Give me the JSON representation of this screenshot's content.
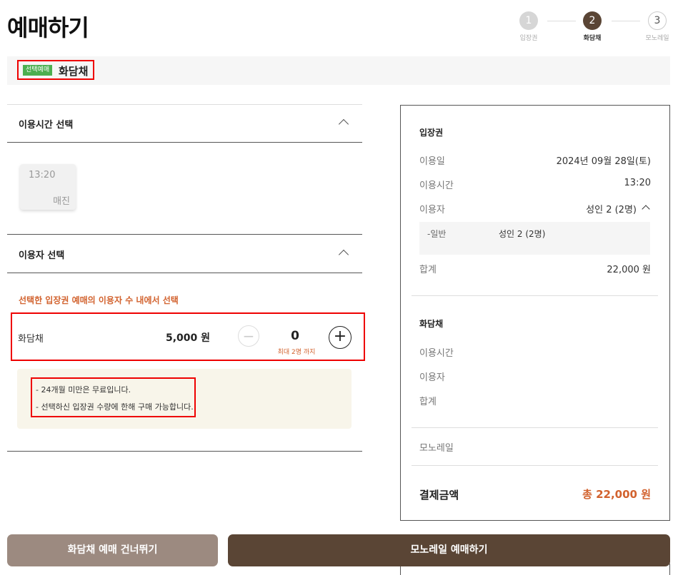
{
  "page": {
    "title": "예매하기"
  },
  "steps": [
    {
      "num": "1",
      "label": "입장권"
    },
    {
      "num": "2",
      "label": "화담채"
    },
    {
      "num": "3",
      "label": "모노레일"
    }
  ],
  "banner": {
    "badge": "선택예매",
    "name": "화담채"
  },
  "time_section": {
    "title": "이용시간 선택",
    "slot_time": "13:20",
    "slot_status": "매진"
  },
  "user_section": {
    "title": "이용자 선택",
    "notice": "선택한 입장권 예매의 이용자 수 내에서 선택",
    "item_name": "화담채",
    "item_price": "5,000 원",
    "minus": "−",
    "plus": "+",
    "quantity": "0",
    "max_note": "최대 2명 까지"
  },
  "info": {
    "line1": "-  24개월 미만은 무료입니다.",
    "line2": "-  선택하신 입장권 수량에 한해 구매 가능합니다."
  },
  "summary": {
    "ticket_header": "입장권",
    "date_label": "이용일",
    "date_value": "2024년 09월 28일(토)",
    "time_label": "이용시간",
    "time_value": "13:20",
    "user_label": "이용자",
    "user_value": "성인 2 (2명)",
    "sub_label": "-일반",
    "sub_value": "성인 2 (2명)",
    "total_label": "합계",
    "total_value": "22,000 원",
    "hwadam_header": "화담채",
    "h_time_label": "이용시간",
    "h_user_label": "이용자",
    "h_total_label": "합계",
    "monorail_label": "모노레일",
    "pay_label": "결제금액",
    "pay_value": "총 22,000 원"
  },
  "buttons": {
    "skip": "화담채 예매 건너뛰기",
    "book": "모노레일 예매하기"
  },
  "colors": {
    "brand": "#5a4535",
    "accent": "#d2622e",
    "badge": "#4caf50"
  }
}
